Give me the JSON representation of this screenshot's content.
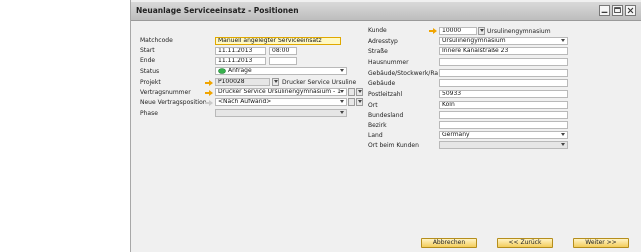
{
  "window": {
    "title": "Neuanlage Serviceeinsatz - Positionen"
  },
  "left_form": {
    "matchcode": {
      "label": "Matchcode",
      "value": "Manuell angelegter Serviceeinsatz"
    },
    "start": {
      "label": "Start",
      "date": "11.11.2013",
      "time": "08:00"
    },
    "ende": {
      "label": "Ende",
      "date": "11.11.2013",
      "time": ""
    },
    "status": {
      "label": "Status",
      "value": "Anfrage"
    },
    "projekt": {
      "label": "Projekt",
      "code": "P100028",
      "name": "Drucker Service Ursuline"
    },
    "vertragsnummer": {
      "label": "Vertragsnummer",
      "value": "Drucker Service Ursulinengymnasium - 1"
    },
    "neue_vertragsposition": {
      "label": "Neue Vertragsposition",
      "value": "<Nach Aufwand>"
    },
    "phase": {
      "label": "Phase",
      "value": ""
    }
  },
  "right_form": {
    "kunde": {
      "label": "Kunde",
      "code": "10000",
      "name": "Ursulinengymnasium"
    },
    "adresstyp": {
      "label": "Adresstyp",
      "value": "Ursulinengymnasium"
    },
    "strasse": {
      "label": "Straße",
      "value": "Innere Kanalstraße 23"
    },
    "hausnummer": {
      "label": "Hausnummer",
      "value": ""
    },
    "gebaeude_stockwerk": {
      "label": "Gebäude/Stockwerk/Ra",
      "value": ""
    },
    "gebaeude": {
      "label": "Gebäude",
      "value": ""
    },
    "postleitzahl": {
      "label": "Postleitzahl",
      "value": "50933"
    },
    "ort": {
      "label": "Ort",
      "value": "Köln"
    },
    "bundesland": {
      "label": "Bundesland",
      "value": ""
    },
    "bezirk": {
      "label": "Bezirk",
      "value": ""
    },
    "land": {
      "label": "Land",
      "value": "Germany"
    },
    "ort_beim_kunden": {
      "label": "Ort beim Kunden",
      "value": ""
    }
  },
  "buttons": {
    "abbrechen": "Abbrechen",
    "zurueck": "<< Zurück",
    "weiter": "Weiter >>"
  },
  "colors": {
    "focus_field": "#fff9c4",
    "button_gradient_bottom": "#f3cd5b",
    "link_arrow": "#f0a400"
  }
}
